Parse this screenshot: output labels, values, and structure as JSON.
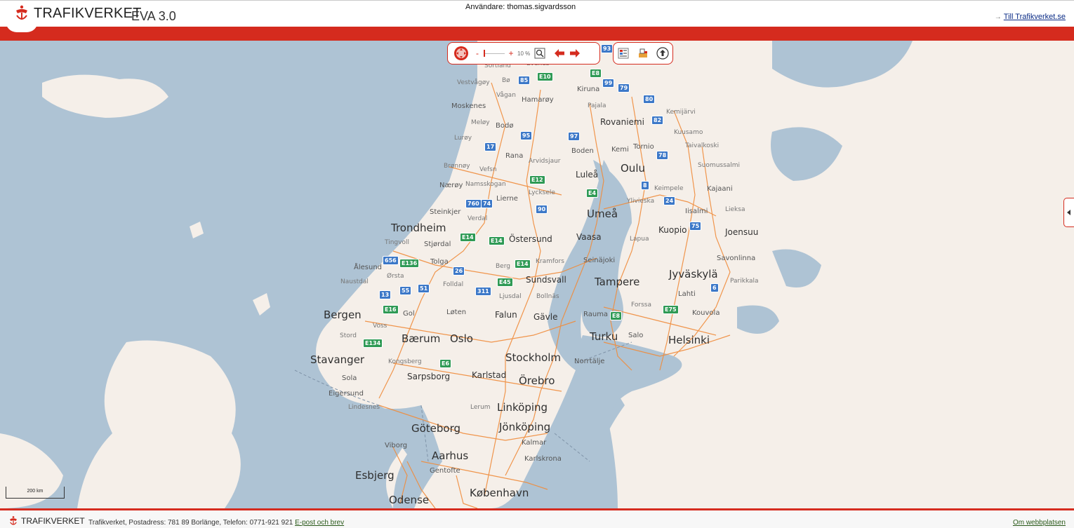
{
  "header": {
    "brand": "TRAFIKVERKET",
    "app_title": "EVA 3.0",
    "user_text": "Användare: thomas.sigvardsson",
    "external_link": "Till Trafikverket.se"
  },
  "toolbar": {
    "zoom_minus": "-",
    "zoom_plus": "+",
    "zoom_level": "10 %",
    "zoom_fraction": 0.1,
    "icons": [
      "pan-icon",
      "zoom-box-icon",
      "back-icon",
      "forward-icon",
      "layers-icon",
      "print-icon",
      "upload-icon"
    ]
  },
  "map": {
    "scale_label": "200 km",
    "colors": {
      "water": "#aec3d4",
      "land": "#f5efe9",
      "roads": "#f08c3c",
      "accent": "#d52b1e"
    },
    "cities_large": {
      "trondheim": "Trondheim",
      "bergen": "Bergen",
      "stavanger": "Stavanger",
      "oslo": "Oslo",
      "baerum": "Bærum",
      "stockholm": "Stockholm",
      "goteborg": "Göteborg",
      "aarhus": "Aarhus",
      "esbjerg": "Esbjerg",
      "odense": "Odense",
      "kobenhavn": "København",
      "helsinki": "Helsinki",
      "tampere": "Tampere",
      "turku": "Turku",
      "oulu": "Oulu",
      "umea": "Umeå",
      "jyvaskyla": "Jyväskylä",
      "linkoping": "Linköping",
      "jonkoping": "Jönköping",
      "orebro": "Örebro",
      "rovaniemi": "Rovaniemi"
    },
    "cities_medium": {
      "sundsvall": "Sundsvall",
      "ostersund": "Östersund",
      "lulea": "Luleå",
      "kuopio": "Kuopio",
      "joensuu": "Joensuu",
      "vaasa": "Vaasa",
      "falun": "Falun",
      "gavle": "Gävle",
      "karlstad": "Karlstad",
      "sarpsborg": "Sarpsborg",
      "kalmar": "Kalmar",
      "karlskrona": "Karlskrona",
      "lahti": "Lahti",
      "kouvola": "Kouvola",
      "savonlinna": "Savonlinna",
      "seinajoki": "Seinäjoki",
      "norrtalje": "Norrtälje",
      "gentofte": "Gentofte",
      "tornio": "Tornio",
      "kiruna": "Kiruna",
      "boden": "Boden",
      "bodo": "Bodø",
      "alesund": "Ålesund",
      "kajaani": "Kajaani",
      "iisalmi": "Iisalmi",
      "salo": "Salo",
      "rauma": "Rauma",
      "viborg": "Viborg",
      "moskenes": "Moskenes",
      "steinkjer": "Steinkjer",
      "sola": "Sola",
      "eigersund": "Eigersund",
      "lierne": "Lierne",
      "rana": "Rana",
      "kemi": "Kemi",
      "harstad": "Hamarøy",
      "gol": "Gol",
      "loten": "Løten",
      "tolga": "Tolga",
      "stjordal": "Stjørdal",
      "naeroy": "Nærøy",
      "stord": "Stord",
      "pajala": "Pajala"
    },
    "cities_small": {
      "sortland": "Sortland",
      "vestvagoy": "Vestvågøy",
      "vagan": "Vågan",
      "evenes": "Evenes",
      "bo": "Bø",
      "meloy": "Meløy",
      "luroy": "Lurøy",
      "bronnoy": "Brønnøy",
      "vefsn": "Vefsn",
      "namsskogan": "Namsskogan",
      "verdal": "Verdal",
      "tingvoll": "Tingvoll",
      "orsta": "Ørsta",
      "naustdal": "Naustdal",
      "voss": "Voss",
      "kongsberg": "Kongsberg",
      "lindesnes": "Lindesnes",
      "folldal": "Folldal",
      "ljusdal": "Ljusdal",
      "bollnas": "Bollnäs",
      "berg": "Berg",
      "kramfors": "Kramfors",
      "lycksele": "Lycksele",
      "arvidsjaur": "Arvidsjaur",
      "lerum": "Lerum",
      "kemijarvi": "Kemijärvi",
      "kuusamo": "Kuusamo",
      "taivalkoski": "Taivalkoski",
      "suomussalmi": "Suomussalmi",
      "keminmaa": "Keimpele",
      "ylivieska": "Ylivieska",
      "lapua": "Lapua",
      "lieksa": "Lieksa",
      "parikkala": "Parikkala",
      "forssa": "Forssa"
    },
    "road_shields": [
      {
        "id": "93",
        "c": "blue"
      },
      {
        "id": "E10",
        "c": "green"
      },
      {
        "id": "85",
        "c": "blue"
      },
      {
        "id": "E8",
        "c": "green"
      },
      {
        "id": "99",
        "c": "blue"
      },
      {
        "id": "79",
        "c": "blue"
      },
      {
        "id": "80",
        "c": "blue"
      },
      {
        "id": "82",
        "c": "blue"
      },
      {
        "id": "95",
        "c": "blue"
      },
      {
        "id": "97",
        "c": "blue"
      },
      {
        "id": "17",
        "c": "blue"
      },
      {
        "id": "78",
        "c": "blue"
      },
      {
        "id": "E12",
        "c": "green"
      },
      {
        "id": "E4",
        "c": "green"
      },
      {
        "id": "8",
        "c": "blue"
      },
      {
        "id": "760",
        "c": "blue"
      },
      {
        "id": "74",
        "c": "blue"
      },
      {
        "id": "90",
        "c": "blue"
      },
      {
        "id": "24",
        "c": "blue"
      },
      {
        "id": "75",
        "c": "blue"
      },
      {
        "id": "E14",
        "c": "green"
      },
      {
        "id": "E14",
        "c": "green"
      },
      {
        "id": "656",
        "c": "blue"
      },
      {
        "id": "E136",
        "c": "green"
      },
      {
        "id": "26",
        "c": "blue"
      },
      {
        "id": "E14",
        "c": "green"
      },
      {
        "id": "13",
        "c": "blue"
      },
      {
        "id": "55",
        "c": "blue"
      },
      {
        "id": "51",
        "c": "blue"
      },
      {
        "id": "311",
        "c": "blue"
      },
      {
        "id": "E45",
        "c": "green"
      },
      {
        "id": "6",
        "c": "blue"
      },
      {
        "id": "E16",
        "c": "green"
      },
      {
        "id": "E75",
        "c": "green"
      },
      {
        "id": "E8",
        "c": "green"
      },
      {
        "id": "E134",
        "c": "green"
      },
      {
        "id": "E6",
        "c": "green"
      }
    ]
  },
  "footer": {
    "brand": "TRAFIKVERKET",
    "address": "Trafikverket, Postadress: 781 89 Borlänge, Telefon: 0771-921 921",
    "mail_link": "E-post och brev",
    "about_link": "Om webbplatsen"
  }
}
